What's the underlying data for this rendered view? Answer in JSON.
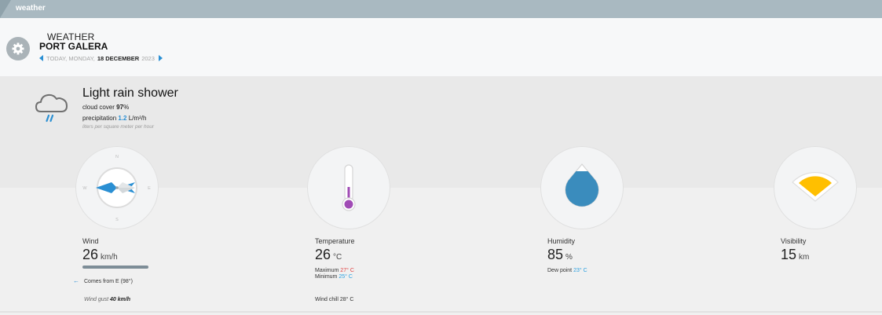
{
  "topbar": {
    "title": "weather"
  },
  "header": {
    "label": "WEATHER",
    "location": "PORT GALERA",
    "date_prefix": "TODAY, MONDAY,",
    "date_value": "18 DECEMBER",
    "date_year": "2023"
  },
  "conditions": {
    "title": "Light rain shower",
    "cloud_cover_label": "cloud cover",
    "cloud_cover_value": "97",
    "cloud_cover_unit": "%",
    "precip_label": "precipitation",
    "precip_value": "1.2",
    "precip_unit": "L/m²/h",
    "precip_hint": "liters per square meter per hour",
    "icon": "moon-cloud-rain-icon"
  },
  "wind": {
    "label": "Wind",
    "value": "26",
    "unit": "km/h",
    "compass": {
      "n": "N",
      "e": "E",
      "s": "S",
      "w": "W"
    },
    "from": "Comes from E (98°)",
    "gust_label": "Wind gust",
    "gust_value": "40 km/h",
    "direction_deg": 98
  },
  "temperature": {
    "label": "Temperature",
    "value": "26",
    "unit": "°C",
    "max_label": "Maximum",
    "max_value": "27° C",
    "min_label": "Minimum",
    "min_value": "25° C",
    "chill": "Wind chill 28° C"
  },
  "humidity": {
    "label": "Humidity",
    "value": "85",
    "unit": "%",
    "dew_label": "Dew point",
    "dew_value": "23° C",
    "level": 0.85
  },
  "visibility": {
    "label": "Visibility",
    "value": "15",
    "unit": "km"
  },
  "colors": {
    "accent": "#2a8fd3",
    "thermometer": "#a04bb5",
    "humidity_drop": "#3a8cbd",
    "visibility_fan": "#ffbf00",
    "max_temp": "#e04444",
    "min_temp": "#2aa0e0"
  }
}
